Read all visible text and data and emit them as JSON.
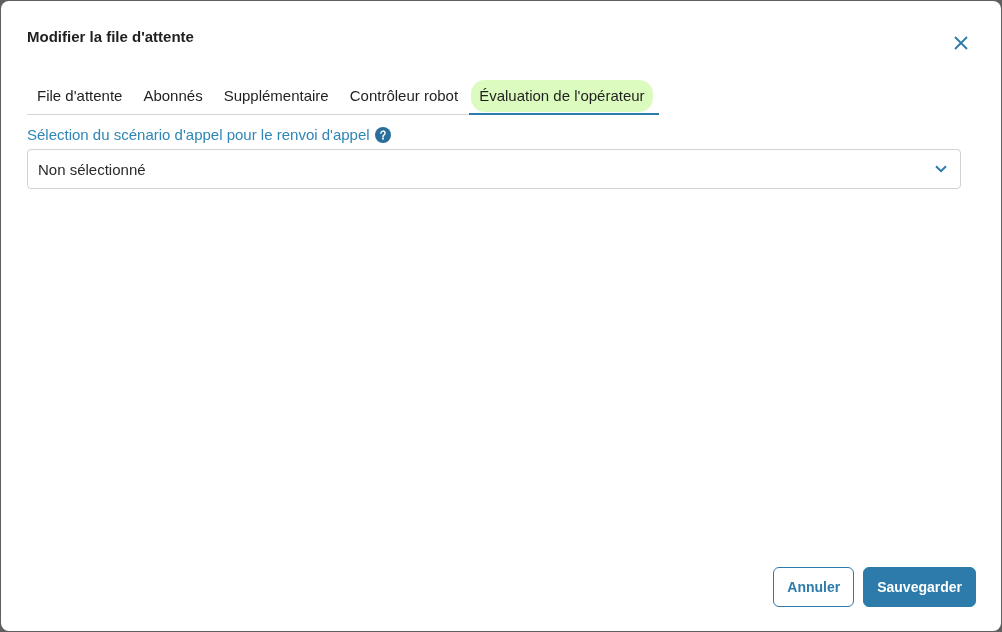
{
  "dialog": {
    "title": "Modifier la file d'attente"
  },
  "tabs": [
    {
      "label": "File d'attente",
      "selected": false
    },
    {
      "label": "Abonnés",
      "selected": false
    },
    {
      "label": "Supplémentaire",
      "selected": false
    },
    {
      "label": "Contrôleur robot",
      "selected": false
    },
    {
      "label": "Évaluation de l'opérateur",
      "selected": true
    }
  ],
  "field": {
    "label": "Sélection du scénario d'appel pour le renvoi d'appel",
    "value": "Non sélectionné"
  },
  "buttons": [
    {
      "label": "Annuler",
      "kind": "outline"
    },
    {
      "label": "Sauvegarder",
      "kind": "filled"
    }
  ]
}
